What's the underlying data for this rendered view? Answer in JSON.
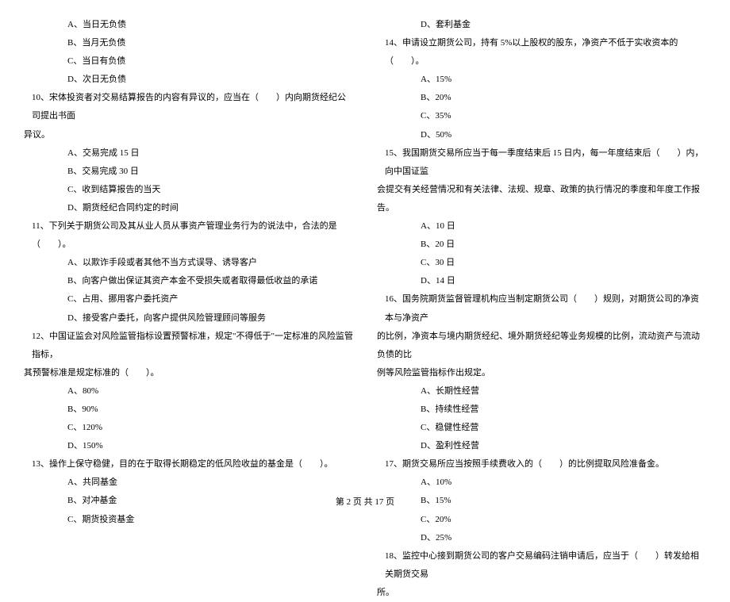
{
  "left": {
    "q9opts": {
      "a": "A、当日无负债",
      "b": "B、当月无负债",
      "c": "C、当日有负债",
      "d": "D、次日无负债"
    },
    "q10": {
      "text": "10、宋体投资者对交易结算报告的内容有异议的，应当在（　　）内向期货经纪公司提出书面",
      "cont": "异议。",
      "a": "A、交易完成 15 日",
      "b": "B、交易完成 30 日",
      "c": "C、收到结算报告的当天",
      "d": "D、期货经纪合同约定的时间"
    },
    "q11": {
      "text": "11、下列关于期货公司及其从业人员从事资产管理业务行为的说法中，合法的是（　　）。",
      "a": "A、以欺诈手段或者其他不当方式误导、诱导客户",
      "b": "B、向客户做出保证其资产本金不受损失或者取得最低收益的承诺",
      "c": "C、占用、挪用客户委托资产",
      "d": "D、接受客户委托，向客户提供风险管理顾问等服务"
    },
    "q12": {
      "text": "12、中国证监会对风险监管指标设置预警标准，规定\"不得低于\"一定标准的风险监管指标，",
      "cont": "其预警标准是规定标准的（　　）。",
      "a": "A、80%",
      "b": "B、90%",
      "c": "C、120%",
      "d": "D、150%"
    },
    "q13": {
      "text": "13、操作上保守稳健，目的在于取得长期稳定的低风险收益的基金是（　　）。",
      "a": "A、共同基金",
      "b": "B、对冲基金",
      "c": "C、期货投资基金"
    }
  },
  "right": {
    "q13d": "D、套利基金",
    "q14": {
      "text": "14、申请设立期货公司，持有 5%以上股权的股东，净资产不低于实收资本的（　　）。",
      "a": "A、15%",
      "b": "B、20%",
      "c": "C、35%",
      "d": "D、50%"
    },
    "q15": {
      "text": "15、我国期货交易所应当于每一季度结束后 15 日内，每一年度结束后（　　）内，向中国证监",
      "cont": "会提交有关经营情况和有关法律、法规、规章、政策的执行情况的季度和年度工作报告。",
      "a": "A、10 日",
      "b": "B、20 日",
      "c": "C、30 日",
      "d": "D、14 日"
    },
    "q16": {
      "text": "16、国务院期货监督管理机构应当制定期货公司（　　）规则，对期货公司的净资本与净资产",
      "cont": "的比例，净资本与境内期货经纪、境外期货经纪等业务规模的比例，流动资产与流动负债的比",
      "cont2": "例等风险监管指标作出规定。",
      "a": "A、长期性经营",
      "b": "B、持续性经营",
      "c": "C、稳健性经营",
      "d": "D、盈利性经营"
    },
    "q17": {
      "text": "17、期货交易所应当按照手续费收入的（　　）的比例提取风险准备金。",
      "a": "A、10%",
      "b": "B、15%",
      "c": "C、20%",
      "d": "D、25%"
    },
    "q18": {
      "text": "18、监控中心接到期货公司的客户交易编码注销申请后，应当于（　　）转发给相关期货交易",
      "cont": "所。"
    }
  },
  "footer": "第 2 页 共 17 页"
}
